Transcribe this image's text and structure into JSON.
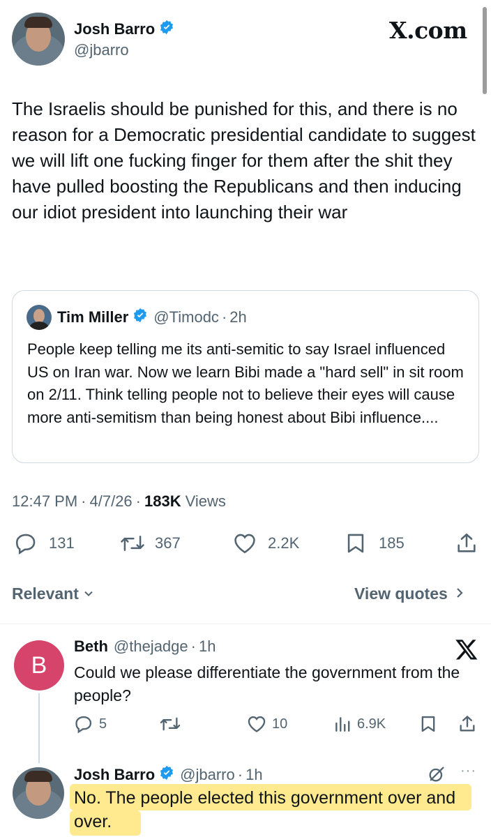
{
  "main_tweet": {
    "author_name": "Josh Barro",
    "author_handle": "@jbarro",
    "brand": "X.com",
    "text": "The Israelis should be punished for this, and there is no reason for a Democratic presidential candidate to suggest we will lift one fucking finger for them after the shit they have pulled boosting the Republicans and then inducing our idiot president into launching their war",
    "time": "12:47 PM",
    "date": "4/7/26",
    "views_count": "183K",
    "views_label": "Views",
    "stats": {
      "replies": "131",
      "reposts": "367",
      "likes": "2.2K",
      "bookmarks": "185"
    }
  },
  "quoted_tweet": {
    "author_name": "Tim Miller",
    "author_handle": "@Timodc",
    "age": "2h",
    "text": "People keep telling me its anti-semitic to say Israel influenced US on Iran war. Now we learn Bibi made a \"hard sell\" in sit room on 2/11. Think telling people not to believe their eyes will cause more anti-semitism than being honest about Bibi influence...."
  },
  "sort_bar": {
    "relevant_label": "Relevant",
    "view_quotes_label": "View quotes"
  },
  "replies": [
    {
      "avatar_letter": "B",
      "author_name": "Beth",
      "author_handle": "@thejadge",
      "age": "1h",
      "text": "Could we please differentiate the government from the people?",
      "stats": {
        "replies": "5",
        "likes": "10",
        "views": "6.9K"
      }
    },
    {
      "author_name": "Josh Barro",
      "author_handle": "@jbarro",
      "age": "1h",
      "text": "No. The people elected this government over and over.",
      "more_label": "···"
    }
  ],
  "colors": {
    "verified": "#1d9bf0",
    "avatar_b": "#d6446b",
    "highlight": "#ffe36a"
  }
}
